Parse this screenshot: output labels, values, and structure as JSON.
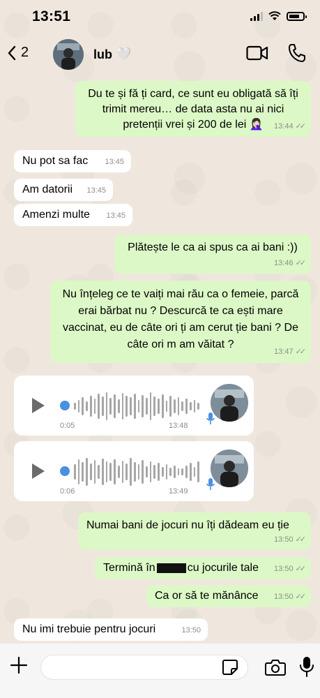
{
  "status_bar": {
    "time": "13:51"
  },
  "header": {
    "back_count": "2",
    "contact_name": "lub",
    "contact_emoji": "🤍"
  },
  "messages": [
    {
      "dir": "out",
      "text": "Du te și fă ți card, ce sunt eu obligată să îți trimit mereu… de data asta nu ai nici pretenții vrei și 200 de lei 🤦🏻‍♀️",
      "time": "13:44"
    },
    {
      "dir": "in",
      "text": "Nu pot sa fac",
      "time": "13:45"
    },
    {
      "dir": "in",
      "text": "Am datorii",
      "time": "13:45"
    },
    {
      "dir": "in",
      "text": "Amenzi multe",
      "time": "13:45"
    },
    {
      "dir": "out",
      "text": "Plătește le ca ai spus ca ai bani :))",
      "time": "13:46"
    },
    {
      "dir": "out",
      "text": "Nu înțeleg ce te vaiți mai rău ca o femeie, parcă erai bărbat nu ? Descurcă te ca ești mare vaccinat, eu de câte ori ți am cerut ție bani ? De câte ori m am văitat ?",
      "time": "13:47"
    },
    {
      "dir": "out",
      "text": "Numai bani de jocuri nu îți dădeam eu ție",
      "time": "13:50"
    },
    {
      "dir": "out",
      "text_before": "Termină în",
      "text_after": "cu jocurile tale",
      "time": "13:50"
    },
    {
      "dir": "out",
      "text": "Ca or să te mănânce",
      "time": "13:50"
    },
    {
      "dir": "in",
      "text": "Nu imi trebuie pentru jocuri",
      "time": "13:50"
    }
  ],
  "voice_notes": [
    {
      "duration": "0:05",
      "time": "13:48"
    },
    {
      "duration": "0:06",
      "time": "13:49"
    }
  ],
  "input": {
    "placeholder": ""
  },
  "icons": {
    "back": "chevron-left-icon",
    "video": "video-call-icon",
    "call": "phone-icon",
    "plus": "plus-icon",
    "sticker": "sticker-icon",
    "camera": "camera-icon",
    "mic": "microphone-icon",
    "play": "play-icon"
  },
  "colors": {
    "outgoing": "#dcf8c6",
    "incoming": "#ffffff",
    "accent": "#4a90e2",
    "background": "#efe7de"
  }
}
